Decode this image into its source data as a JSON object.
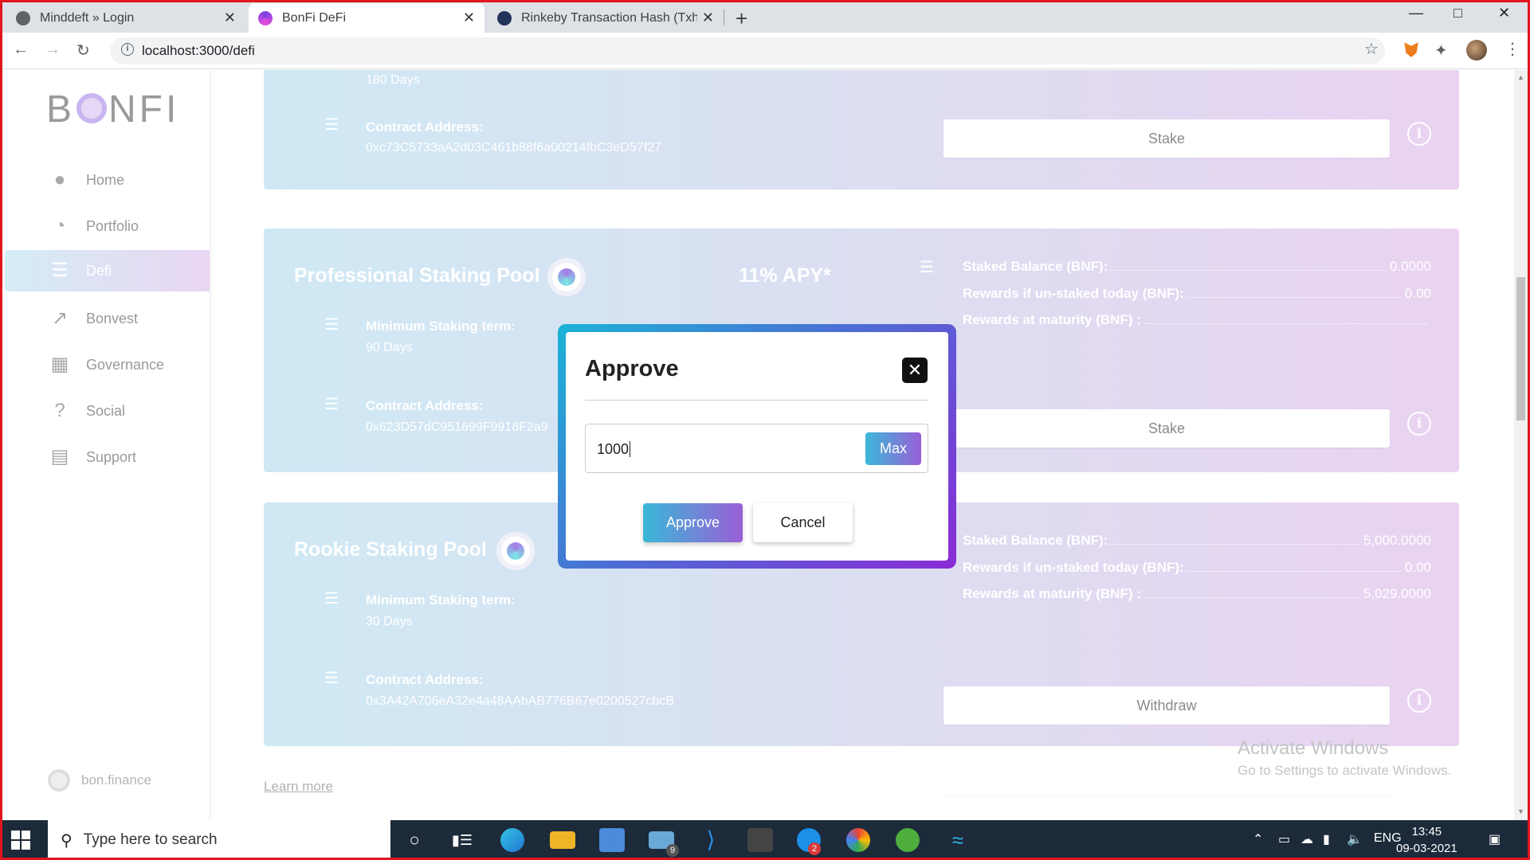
{
  "browser": {
    "tabs": [
      {
        "title": "Minddeft » Login",
        "close": "✕"
      },
      {
        "title": "BonFi DeFi",
        "close": "✕"
      },
      {
        "title": "Rinkeby Transaction Hash (Txhash",
        "close": "✕"
      }
    ],
    "new_tab": "+",
    "url": "localhost:3000/defi"
  },
  "sidebar": {
    "logo": {
      "left": "B",
      "right": "NFI"
    },
    "items": [
      {
        "label": "Home",
        "icon": "person-icon"
      },
      {
        "label": "Portfolio",
        "icon": "pie-chart-icon"
      },
      {
        "label": "Defi",
        "icon": "list-icon"
      },
      {
        "label": "Bonvest",
        "icon": "trend-chart-icon"
      },
      {
        "label": "Governance",
        "icon": "grid-icon"
      },
      {
        "label": "Social",
        "icon": "question-icon"
      },
      {
        "label": "Support",
        "icon": "chat-icon"
      }
    ],
    "footer": "bon.finance"
  },
  "pools": {
    "top": {
      "term_value": "180 Days",
      "contract_label": "Contract Address:",
      "contract_value": "0xc73C5733aA2d03C461b88f6a00214fbC3eD57f27",
      "button": "Stake"
    },
    "professional": {
      "title": "Professional Staking Pool",
      "apy": "11% APY*",
      "term_label": "Minimum Staking term:",
      "term_value": "90 Days",
      "contract_label": "Contract Address:",
      "contract_value": "0x623D57dC951699F9918F2a9",
      "staked_label": "Staked Balance (BNF):",
      "staked_value": "0.0000",
      "rewards_today_label": "Rewards if un-staked today (BNF):",
      "rewards_today_value": "0.00",
      "rewards_maturity_label": "Rewards at maturity (BNF) :",
      "rewards_maturity_value": "",
      "button": "Stake"
    },
    "rookie": {
      "title": "Rookie Staking Pool",
      "term_label": "Minimum Staking term:",
      "term_value": "30 Days",
      "contract_label": "Contract Address:",
      "contract_value": "0x3A42A706eA32e4a48AAbAB776B67e0200527cbcB",
      "staked_label": "Staked Balance (BNF):",
      "staked_value": "5,000.0000",
      "rewards_today_label": "Rewards if un-staked today (BNF):",
      "rewards_today_value": "0.00",
      "rewards_maturity_label": "Rewards at maturity (BNF) :",
      "rewards_maturity_value": "5,029.0000",
      "button": "Withdraw"
    }
  },
  "learn_more": "Learn more",
  "watermark": {
    "line1": "Activate Windows",
    "line2": "Go to Settings to activate Windows."
  },
  "modal": {
    "title": "Approve",
    "amount": "1000",
    "max_label": "Max",
    "approve_label": "Approve",
    "cancel_label": "Cancel"
  },
  "taskbar": {
    "search_placeholder": "Type here to search",
    "mail_badge": "9",
    "skype_badge": "2",
    "lang": "ENG",
    "time": "13:45",
    "date": "09-03-2021"
  },
  "colors": {
    "accent_cyan": "#3ab8d8",
    "accent_purple": "#9a5ed6",
    "frame_red": "#e0161e"
  }
}
